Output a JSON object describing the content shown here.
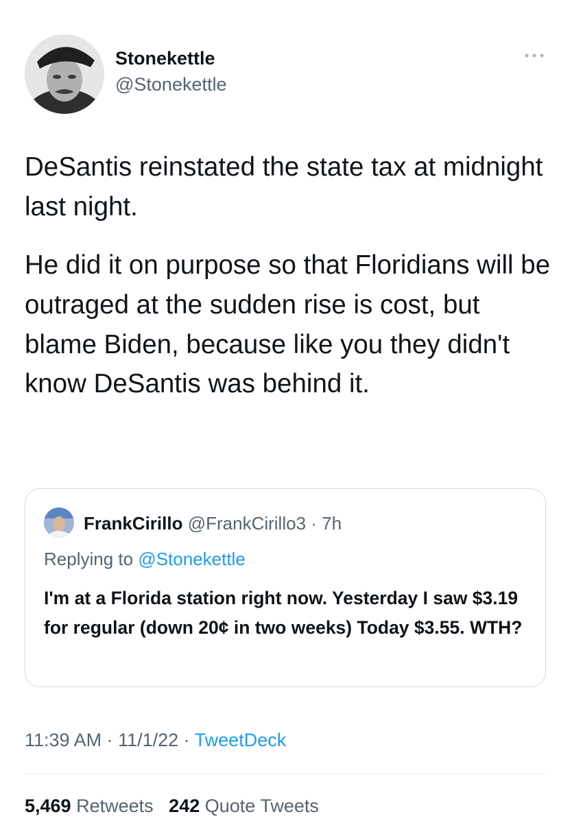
{
  "author": {
    "display_name": "Stonekettle",
    "handle": "@Stonekettle"
  },
  "menu": {
    "icon": "more-dots-icon"
  },
  "tweet": {
    "paragraphs": [
      "DeSantis reinstated the state tax at midnight last night.",
      "He did it on purpose so that Floridians will be outraged at the sudden rise is cost, but blame Biden, because like you they didn't know DeSantis was behind it."
    ]
  },
  "quote": {
    "display_name": "FrankCirillo",
    "handle_time": "@FrankCirillo3 · 7h",
    "replying_prefix": "Replying to",
    "replying_handle": "@Stonekettle",
    "text": "I'm at a Florida station right now. Yesterday I saw $3.19 for regular (down 20¢ in two weeks) Today $3.55. WTH?"
  },
  "meta": {
    "time_date": "11:39 AM · 11/1/22 ·",
    "source": "TweetDeck"
  },
  "stats": {
    "retweets_count": "5,469",
    "retweets_label": "Retweets",
    "quotes_count": "242",
    "quotes_label": "Quote Tweets"
  },
  "colors": {
    "link_blue": "#1d9bf0",
    "secondary_text": "#536471",
    "primary_text": "#0f1419",
    "border": "#cfd9de"
  }
}
